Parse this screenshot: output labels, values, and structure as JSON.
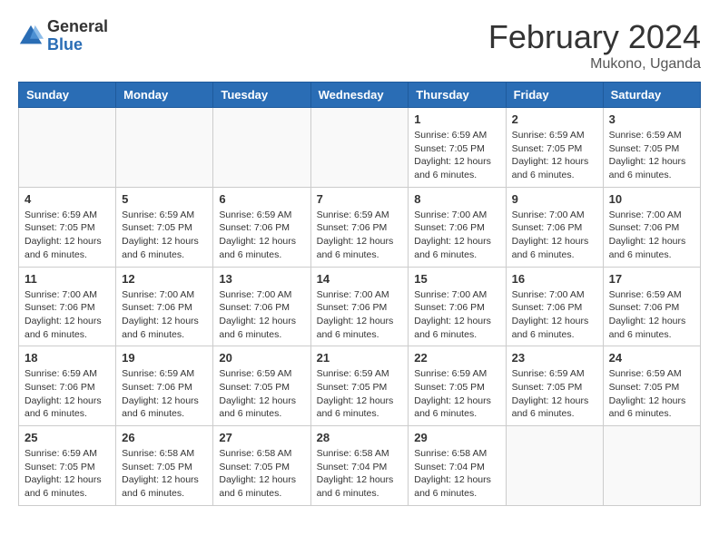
{
  "header": {
    "logo_general": "General",
    "logo_blue": "Blue",
    "month_title": "February 2024",
    "location": "Mukono, Uganda"
  },
  "weekdays": [
    "Sunday",
    "Monday",
    "Tuesday",
    "Wednesday",
    "Thursday",
    "Friday",
    "Saturday"
  ],
  "weeks": [
    [
      {
        "day": "",
        "info": ""
      },
      {
        "day": "",
        "info": ""
      },
      {
        "day": "",
        "info": ""
      },
      {
        "day": "",
        "info": ""
      },
      {
        "day": "1",
        "info": "Sunrise: 6:59 AM\nSunset: 7:05 PM\nDaylight: 12 hours\nand 6 minutes."
      },
      {
        "day": "2",
        "info": "Sunrise: 6:59 AM\nSunset: 7:05 PM\nDaylight: 12 hours\nand 6 minutes."
      },
      {
        "day": "3",
        "info": "Sunrise: 6:59 AM\nSunset: 7:05 PM\nDaylight: 12 hours\nand 6 minutes."
      }
    ],
    [
      {
        "day": "4",
        "info": "Sunrise: 6:59 AM\nSunset: 7:05 PM\nDaylight: 12 hours\nand 6 minutes."
      },
      {
        "day": "5",
        "info": "Sunrise: 6:59 AM\nSunset: 7:05 PM\nDaylight: 12 hours\nand 6 minutes."
      },
      {
        "day": "6",
        "info": "Sunrise: 6:59 AM\nSunset: 7:06 PM\nDaylight: 12 hours\nand 6 minutes."
      },
      {
        "day": "7",
        "info": "Sunrise: 6:59 AM\nSunset: 7:06 PM\nDaylight: 12 hours\nand 6 minutes."
      },
      {
        "day": "8",
        "info": "Sunrise: 7:00 AM\nSunset: 7:06 PM\nDaylight: 12 hours\nand 6 minutes."
      },
      {
        "day": "9",
        "info": "Sunrise: 7:00 AM\nSunset: 7:06 PM\nDaylight: 12 hours\nand 6 minutes."
      },
      {
        "day": "10",
        "info": "Sunrise: 7:00 AM\nSunset: 7:06 PM\nDaylight: 12 hours\nand 6 minutes."
      }
    ],
    [
      {
        "day": "11",
        "info": "Sunrise: 7:00 AM\nSunset: 7:06 PM\nDaylight: 12 hours\nand 6 minutes."
      },
      {
        "day": "12",
        "info": "Sunrise: 7:00 AM\nSunset: 7:06 PM\nDaylight: 12 hours\nand 6 minutes."
      },
      {
        "day": "13",
        "info": "Sunrise: 7:00 AM\nSunset: 7:06 PM\nDaylight: 12 hours\nand 6 minutes."
      },
      {
        "day": "14",
        "info": "Sunrise: 7:00 AM\nSunset: 7:06 PM\nDaylight: 12 hours\nand 6 minutes."
      },
      {
        "day": "15",
        "info": "Sunrise: 7:00 AM\nSunset: 7:06 PM\nDaylight: 12 hours\nand 6 minutes."
      },
      {
        "day": "16",
        "info": "Sunrise: 7:00 AM\nSunset: 7:06 PM\nDaylight: 12 hours\nand 6 minutes."
      },
      {
        "day": "17",
        "info": "Sunrise: 6:59 AM\nSunset: 7:06 PM\nDaylight: 12 hours\nand 6 minutes."
      }
    ],
    [
      {
        "day": "18",
        "info": "Sunrise: 6:59 AM\nSunset: 7:06 PM\nDaylight: 12 hours\nand 6 minutes."
      },
      {
        "day": "19",
        "info": "Sunrise: 6:59 AM\nSunset: 7:06 PM\nDaylight: 12 hours\nand 6 minutes."
      },
      {
        "day": "20",
        "info": "Sunrise: 6:59 AM\nSunset: 7:05 PM\nDaylight: 12 hours\nand 6 minutes."
      },
      {
        "day": "21",
        "info": "Sunrise: 6:59 AM\nSunset: 7:05 PM\nDaylight: 12 hours\nand 6 minutes."
      },
      {
        "day": "22",
        "info": "Sunrise: 6:59 AM\nSunset: 7:05 PM\nDaylight: 12 hours\nand 6 minutes."
      },
      {
        "day": "23",
        "info": "Sunrise: 6:59 AM\nSunset: 7:05 PM\nDaylight: 12 hours\nand 6 minutes."
      },
      {
        "day": "24",
        "info": "Sunrise: 6:59 AM\nSunset: 7:05 PM\nDaylight: 12 hours\nand 6 minutes."
      }
    ],
    [
      {
        "day": "25",
        "info": "Sunrise: 6:59 AM\nSunset: 7:05 PM\nDaylight: 12 hours\nand 6 minutes."
      },
      {
        "day": "26",
        "info": "Sunrise: 6:58 AM\nSunset: 7:05 PM\nDaylight: 12 hours\nand 6 minutes."
      },
      {
        "day": "27",
        "info": "Sunrise: 6:58 AM\nSunset: 7:05 PM\nDaylight: 12 hours\nand 6 minutes."
      },
      {
        "day": "28",
        "info": "Sunrise: 6:58 AM\nSunset: 7:04 PM\nDaylight: 12 hours\nand 6 minutes."
      },
      {
        "day": "29",
        "info": "Sunrise: 6:58 AM\nSunset: 7:04 PM\nDaylight: 12 hours\nand 6 minutes."
      },
      {
        "day": "",
        "info": ""
      },
      {
        "day": "",
        "info": ""
      }
    ]
  ]
}
